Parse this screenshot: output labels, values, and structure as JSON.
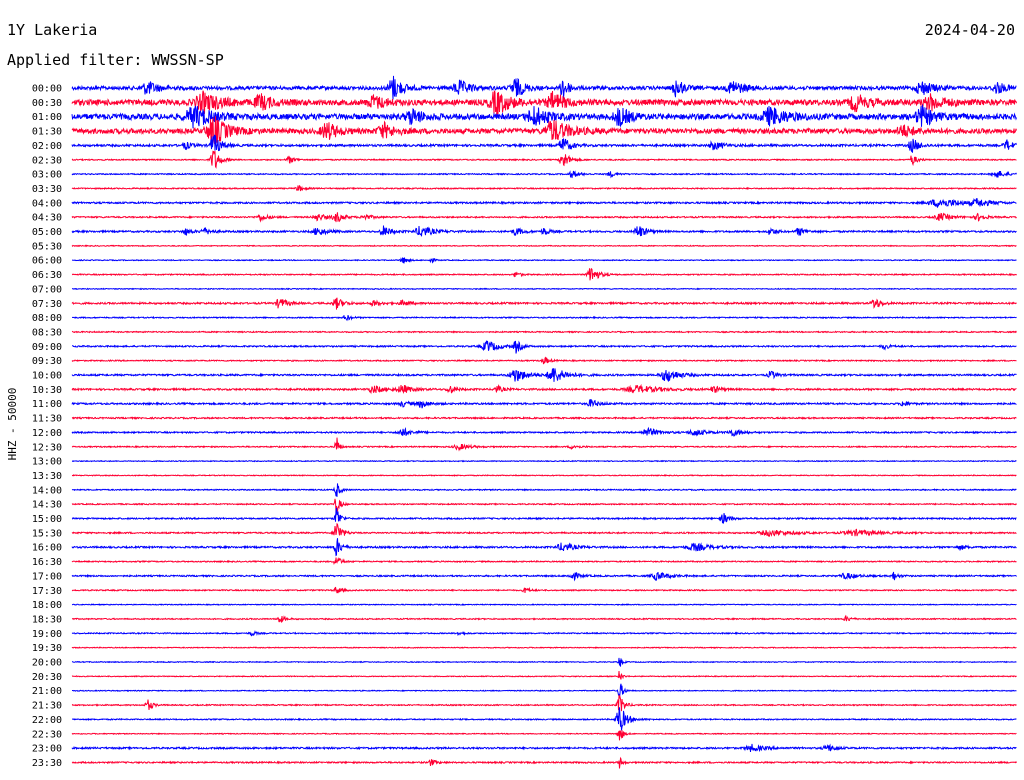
{
  "header": {
    "station": "1Y Lakeria",
    "date": "2024-04-20",
    "filter": "Applied filter: WWSSN-SP"
  },
  "chart_data": {
    "type": "line",
    "ylabel": "HHZ - 50000",
    "colors": [
      "#0000ff",
      "#ff0033"
    ],
    "rows": [
      {
        "time": "00:00",
        "color": "#0000ff",
        "noise": 0.25,
        "events": [
          {
            "x": 0.08,
            "amp": 0.9,
            "width": 0.01
          },
          {
            "x": 0.34,
            "amp": 1.7,
            "width": 0.008
          },
          {
            "x": 0.41,
            "amp": 1.0,
            "width": 0.01
          },
          {
            "x": 0.47,
            "amp": 1.4,
            "width": 0.008
          },
          {
            "x": 0.52,
            "amp": 2.0,
            "width": 0.004
          },
          {
            "x": 0.64,
            "amp": 1.4,
            "width": 0.006
          },
          {
            "x": 0.7,
            "amp": 1.0,
            "width": 0.01
          },
          {
            "x": 0.9,
            "amp": 1.0,
            "width": 0.01
          },
          {
            "x": 0.98,
            "amp": 0.8,
            "width": 0.008
          }
        ]
      },
      {
        "time": "00:30",
        "color": "#ff0033",
        "noise": 0.4,
        "events": [
          {
            "x": 0.14,
            "amp": 1.3,
            "width": 0.015
          },
          {
            "x": 0.2,
            "amp": 1.0,
            "width": 0.01
          },
          {
            "x": 0.32,
            "amp": 0.9,
            "width": 0.01
          },
          {
            "x": 0.45,
            "amp": 1.6,
            "width": 0.012
          },
          {
            "x": 0.51,
            "amp": 1.3,
            "width": 0.01
          },
          {
            "x": 0.83,
            "amp": 1.1,
            "width": 0.01
          },
          {
            "x": 0.91,
            "amp": 1.0,
            "width": 0.012
          }
        ]
      },
      {
        "time": "01:00",
        "color": "#0000ff",
        "noise": 0.4,
        "events": [
          {
            "x": 0.13,
            "amp": 1.4,
            "width": 0.015
          },
          {
            "x": 0.36,
            "amp": 1.0,
            "width": 0.01
          },
          {
            "x": 0.49,
            "amp": 1.3,
            "width": 0.012
          },
          {
            "x": 0.58,
            "amp": 1.2,
            "width": 0.01
          },
          {
            "x": 0.74,
            "amp": 1.2,
            "width": 0.015
          },
          {
            "x": 0.9,
            "amp": 1.4,
            "width": 0.01
          }
        ]
      },
      {
        "time": "01:30",
        "color": "#ff0033",
        "noise": 0.35,
        "events": [
          {
            "x": 0.15,
            "amp": 2.0,
            "width": 0.012
          },
          {
            "x": 0.27,
            "amp": 1.2,
            "width": 0.01
          },
          {
            "x": 0.33,
            "amp": 1.0,
            "width": 0.01
          },
          {
            "x": 0.51,
            "amp": 1.5,
            "width": 0.014
          },
          {
            "x": 0.88,
            "amp": 0.8,
            "width": 0.01
          }
        ]
      },
      {
        "time": "02:00",
        "color": "#0000ff",
        "noise": 0.15,
        "events": [
          {
            "x": 0.12,
            "amp": 0.5,
            "width": 0.006
          },
          {
            "x": 0.15,
            "amp": 1.6,
            "width": 0.006
          },
          {
            "x": 0.52,
            "amp": 1.2,
            "width": 0.006
          },
          {
            "x": 0.68,
            "amp": 0.6,
            "width": 0.008
          },
          {
            "x": 0.89,
            "amp": 1.0,
            "width": 0.006
          },
          {
            "x": 0.99,
            "amp": 0.8,
            "width": 0.005
          }
        ]
      },
      {
        "time": "02:30",
        "color": "#ff0033",
        "noise": 0.08,
        "events": [
          {
            "x": 0.15,
            "amp": 1.8,
            "width": 0.005
          },
          {
            "x": 0.23,
            "amp": 0.5,
            "width": 0.005
          },
          {
            "x": 0.52,
            "amp": 1.4,
            "width": 0.005
          },
          {
            "x": 0.89,
            "amp": 0.8,
            "width": 0.004
          }
        ]
      },
      {
        "time": "03:00",
        "color": "#0000ff",
        "noise": 0.08,
        "events": [
          {
            "x": 0.53,
            "amp": 0.5,
            "width": 0.006
          },
          {
            "x": 0.57,
            "amp": 0.4,
            "width": 0.005
          },
          {
            "x": 0.98,
            "amp": 0.5,
            "width": 0.008
          }
        ]
      },
      {
        "time": "03:30",
        "color": "#ff0033",
        "noise": 0.08,
        "events": [
          {
            "x": 0.24,
            "amp": 0.4,
            "width": 0.005
          }
        ]
      },
      {
        "time": "04:00",
        "color": "#0000ff",
        "noise": 0.12,
        "events": [
          {
            "x": 0.92,
            "amp": 0.6,
            "width": 0.02
          },
          {
            "x": 0.96,
            "amp": 0.5,
            "width": 0.01
          }
        ]
      },
      {
        "time": "04:30",
        "color": "#ff0033",
        "noise": 0.1,
        "events": [
          {
            "x": 0.2,
            "amp": 0.5,
            "width": 0.006
          },
          {
            "x": 0.26,
            "amp": 0.5,
            "width": 0.008
          },
          {
            "x": 0.28,
            "amp": 0.7,
            "width": 0.006
          },
          {
            "x": 0.31,
            "amp": 0.4,
            "width": 0.006
          },
          {
            "x": 0.92,
            "amp": 0.5,
            "width": 0.01
          },
          {
            "x": 0.96,
            "amp": 0.5,
            "width": 0.006
          }
        ]
      },
      {
        "time": "05:00",
        "color": "#0000ff",
        "noise": 0.12,
        "events": [
          {
            "x": 0.12,
            "amp": 0.5,
            "width": 0.005
          },
          {
            "x": 0.14,
            "amp": 0.5,
            "width": 0.006
          },
          {
            "x": 0.26,
            "amp": 0.6,
            "width": 0.008
          },
          {
            "x": 0.33,
            "amp": 0.8,
            "width": 0.006
          },
          {
            "x": 0.37,
            "amp": 0.8,
            "width": 0.01
          },
          {
            "x": 0.47,
            "amp": 0.6,
            "width": 0.006
          },
          {
            "x": 0.5,
            "amp": 0.5,
            "width": 0.005
          },
          {
            "x": 0.6,
            "amp": 1.0,
            "width": 0.006
          },
          {
            "x": 0.74,
            "amp": 0.5,
            "width": 0.005
          },
          {
            "x": 0.77,
            "amp": 0.6,
            "width": 0.005
          }
        ]
      },
      {
        "time": "05:30",
        "color": "#ff0033",
        "noise": 0.06,
        "events": []
      },
      {
        "time": "06:00",
        "color": "#0000ff",
        "noise": 0.06,
        "events": [
          {
            "x": 0.35,
            "amp": 0.6,
            "width": 0.004
          },
          {
            "x": 0.38,
            "amp": 0.4,
            "width": 0.003
          }
        ]
      },
      {
        "time": "06:30",
        "color": "#ff0033",
        "noise": 0.08,
        "events": [
          {
            "x": 0.47,
            "amp": 0.4,
            "width": 0.004
          },
          {
            "x": 0.55,
            "amp": 1.3,
            "width": 0.006
          }
        ]
      },
      {
        "time": "07:00",
        "color": "#0000ff",
        "noise": 0.06,
        "events": []
      },
      {
        "time": "07:30",
        "color": "#ff0033",
        "noise": 0.12,
        "events": [
          {
            "x": 0.22,
            "amp": 0.8,
            "width": 0.006
          },
          {
            "x": 0.28,
            "amp": 0.8,
            "width": 0.006
          },
          {
            "x": 0.32,
            "amp": 0.4,
            "width": 0.006
          },
          {
            "x": 0.35,
            "amp": 0.4,
            "width": 0.006
          },
          {
            "x": 0.85,
            "amp": 0.9,
            "width": 0.005
          }
        ]
      },
      {
        "time": "08:00",
        "color": "#0000ff",
        "noise": 0.08,
        "events": [
          {
            "x": 0.29,
            "amp": 0.5,
            "width": 0.004
          }
        ]
      },
      {
        "time": "08:30",
        "color": "#ff0033",
        "noise": 0.08,
        "events": []
      },
      {
        "time": "09:00",
        "color": "#0000ff",
        "noise": 0.1,
        "events": [
          {
            "x": 0.44,
            "amp": 0.8,
            "width": 0.01
          },
          {
            "x": 0.47,
            "amp": 1.0,
            "width": 0.004
          },
          {
            "x": 0.86,
            "amp": 0.4,
            "width": 0.005
          }
        ]
      },
      {
        "time": "09:30",
        "color": "#ff0033",
        "noise": 0.08,
        "events": [
          {
            "x": 0.5,
            "amp": 0.6,
            "width": 0.004
          }
        ]
      },
      {
        "time": "10:00",
        "color": "#0000ff",
        "noise": 0.12,
        "events": [
          {
            "x": 0.47,
            "amp": 1.0,
            "width": 0.01
          },
          {
            "x": 0.51,
            "amp": 1.2,
            "width": 0.01
          },
          {
            "x": 0.63,
            "amp": 1.0,
            "width": 0.01
          },
          {
            "x": 0.74,
            "amp": 0.6,
            "width": 0.005
          }
        ]
      },
      {
        "time": "10:30",
        "color": "#ff0033",
        "noise": 0.12,
        "events": [
          {
            "x": 0.32,
            "amp": 0.5,
            "width": 0.01
          },
          {
            "x": 0.35,
            "amp": 0.6,
            "width": 0.008
          },
          {
            "x": 0.4,
            "amp": 0.6,
            "width": 0.005
          },
          {
            "x": 0.45,
            "amp": 0.5,
            "width": 0.005
          },
          {
            "x": 0.6,
            "amp": 0.5,
            "width": 0.02
          },
          {
            "x": 0.68,
            "amp": 0.5,
            "width": 0.005
          }
        ]
      },
      {
        "time": "11:00",
        "color": "#0000ff",
        "noise": 0.12,
        "events": [
          {
            "x": 0.35,
            "amp": 0.4,
            "width": 0.006
          },
          {
            "x": 0.37,
            "amp": 0.6,
            "width": 0.006
          },
          {
            "x": 0.55,
            "amp": 0.6,
            "width": 0.006
          },
          {
            "x": 0.88,
            "amp": 0.5,
            "width": 0.004
          }
        ]
      },
      {
        "time": "11:30",
        "color": "#ff0033",
        "noise": 0.1,
        "events": []
      },
      {
        "time": "12:00",
        "color": "#0000ff",
        "noise": 0.1,
        "events": [
          {
            "x": 0.35,
            "amp": 0.6,
            "width": 0.008
          },
          {
            "x": 0.61,
            "amp": 0.6,
            "width": 0.01
          },
          {
            "x": 0.66,
            "amp": 0.5,
            "width": 0.01
          },
          {
            "x": 0.7,
            "amp": 0.5,
            "width": 0.008
          }
        ]
      },
      {
        "time": "12:30",
        "color": "#ff0033",
        "noise": 0.08,
        "events": [
          {
            "x": 0.28,
            "amp": 2.0,
            "width": 0.002
          },
          {
            "x": 0.41,
            "amp": 0.4,
            "width": 0.01
          },
          {
            "x": 0.53,
            "amp": 0.3,
            "width": 0.006
          }
        ]
      },
      {
        "time": "13:00",
        "color": "#0000ff",
        "noise": 0.06,
        "events": []
      },
      {
        "time": "13:30",
        "color": "#ff0033",
        "noise": 0.06,
        "events": []
      },
      {
        "time": "14:00",
        "color": "#0000ff",
        "noise": 0.08,
        "events": [
          {
            "x": 0.28,
            "amp": 1.2,
            "width": 0.003
          }
        ]
      },
      {
        "time": "14:30",
        "color": "#ff0033",
        "noise": 0.08,
        "events": [
          {
            "x": 0.28,
            "amp": 1.4,
            "width": 0.003
          }
        ]
      },
      {
        "time": "15:00",
        "color": "#0000ff",
        "noise": 0.1,
        "events": [
          {
            "x": 0.28,
            "amp": 2.0,
            "width": 0.003
          },
          {
            "x": 0.69,
            "amp": 0.8,
            "width": 0.005
          }
        ]
      },
      {
        "time": "15:30",
        "color": "#ff0033",
        "noise": 0.1,
        "events": [
          {
            "x": 0.28,
            "amp": 2.0,
            "width": 0.004
          },
          {
            "x": 0.74,
            "amp": 0.4,
            "width": 0.02
          },
          {
            "x": 0.83,
            "amp": 0.4,
            "width": 0.02
          }
        ]
      },
      {
        "time": "16:00",
        "color": "#0000ff",
        "noise": 0.12,
        "events": [
          {
            "x": 0.28,
            "amp": 1.4,
            "width": 0.004
          },
          {
            "x": 0.52,
            "amp": 0.6,
            "width": 0.01
          },
          {
            "x": 0.66,
            "amp": 0.5,
            "width": 0.015
          },
          {
            "x": 0.94,
            "amp": 0.4,
            "width": 0.005
          }
        ]
      },
      {
        "time": "16:30",
        "color": "#ff0033",
        "noise": 0.08,
        "events": [
          {
            "x": 0.28,
            "amp": 0.8,
            "width": 0.004
          }
        ]
      },
      {
        "time": "17:00",
        "color": "#0000ff",
        "noise": 0.1,
        "events": [
          {
            "x": 0.53,
            "amp": 0.6,
            "width": 0.006
          },
          {
            "x": 0.62,
            "amp": 0.6,
            "width": 0.01
          },
          {
            "x": 0.82,
            "amp": 0.4,
            "width": 0.01
          },
          {
            "x": 0.87,
            "amp": 0.6,
            "width": 0.004
          }
        ]
      },
      {
        "time": "17:30",
        "color": "#ff0033",
        "noise": 0.08,
        "events": [
          {
            "x": 0.28,
            "amp": 0.6,
            "width": 0.004
          },
          {
            "x": 0.48,
            "amp": 0.4,
            "width": 0.004
          }
        ]
      },
      {
        "time": "18:00",
        "color": "#0000ff",
        "noise": 0.06,
        "events": []
      },
      {
        "time": "18:30",
        "color": "#ff0033",
        "noise": 0.08,
        "events": [
          {
            "x": 0.22,
            "amp": 0.6,
            "width": 0.004
          },
          {
            "x": 0.82,
            "amp": 0.4,
            "width": 0.004
          }
        ]
      },
      {
        "time": "19:00",
        "color": "#0000ff",
        "noise": 0.08,
        "events": [
          {
            "x": 0.19,
            "amp": 0.4,
            "width": 0.004
          },
          {
            "x": 0.41,
            "amp": 0.3,
            "width": 0.004
          }
        ]
      },
      {
        "time": "19:30",
        "color": "#ff0033",
        "noise": 0.06,
        "events": []
      },
      {
        "time": "20:00",
        "color": "#0000ff",
        "noise": 0.06,
        "events": [
          {
            "x": 0.58,
            "amp": 1.0,
            "width": 0.002
          }
        ]
      },
      {
        "time": "20:30",
        "color": "#ff0033",
        "noise": 0.06,
        "events": [
          {
            "x": 0.58,
            "amp": 1.0,
            "width": 0.002
          }
        ]
      },
      {
        "time": "21:00",
        "color": "#0000ff",
        "noise": 0.06,
        "events": [
          {
            "x": 0.58,
            "amp": 1.5,
            "width": 0.003
          }
        ]
      },
      {
        "time": "21:30",
        "color": "#ff0033",
        "noise": 0.08,
        "events": [
          {
            "x": 0.08,
            "amp": 0.9,
            "width": 0.004
          },
          {
            "x": 0.58,
            "amp": 1.5,
            "width": 0.004
          }
        ]
      },
      {
        "time": "22:00",
        "color": "#0000ff",
        "noise": 0.08,
        "events": [
          {
            "x": 0.58,
            "amp": 2.0,
            "width": 0.006
          }
        ]
      },
      {
        "time": "22:30",
        "color": "#ff0033",
        "noise": 0.06,
        "events": [
          {
            "x": 0.58,
            "amp": 1.2,
            "width": 0.003
          }
        ]
      },
      {
        "time": "23:00",
        "color": "#0000ff",
        "noise": 0.12,
        "events": [
          {
            "x": 0.72,
            "amp": 0.5,
            "width": 0.01
          },
          {
            "x": 0.8,
            "amp": 0.6,
            "width": 0.006
          }
        ]
      },
      {
        "time": "23:30",
        "color": "#ff0033",
        "noise": 0.1,
        "events": [
          {
            "x": 0.38,
            "amp": 0.5,
            "width": 0.004
          },
          {
            "x": 0.58,
            "amp": 1.0,
            "width": 0.002
          }
        ]
      }
    ]
  }
}
